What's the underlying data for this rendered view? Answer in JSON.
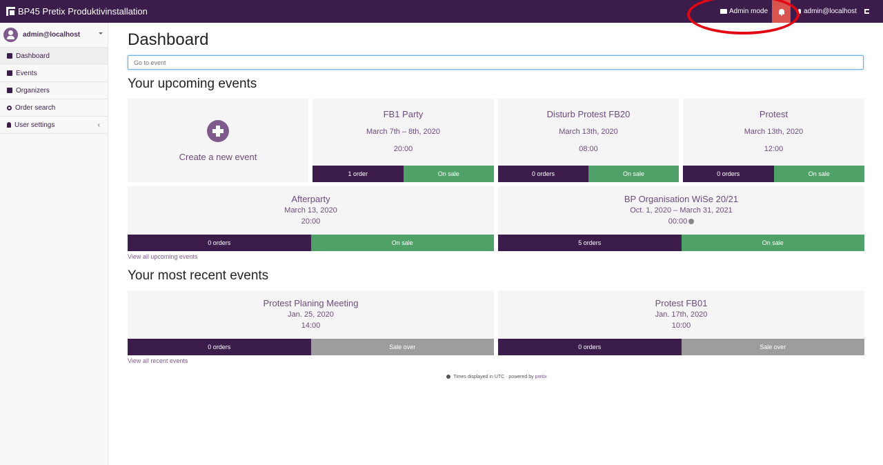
{
  "topbar": {
    "title": "BP45 Pretix Produktivinstallation",
    "admin_mode_label": "Admin mode",
    "user_label": "admin@localhost",
    "colors": {
      "navbar": "#3b1c4a",
      "bell": "#d9534f",
      "annotation": "#e30613"
    }
  },
  "sidebar": {
    "user": "admin@localhost",
    "items": [
      {
        "label": "Dashboard",
        "icon": "dashboard-icon"
      },
      {
        "label": "Events",
        "icon": "calendar-icon"
      },
      {
        "label": "Organizers",
        "icon": "users-icon"
      },
      {
        "label": "Order search",
        "icon": "search-icon"
      },
      {
        "label": "User settings",
        "icon": "user-icon"
      }
    ]
  },
  "main": {
    "title": "Dashboard",
    "search_placeholder": "Go to event",
    "upcoming_title": "Your upcoming events",
    "recent_title": "Your most recent events",
    "create_event_label": "Create a new event",
    "view_upcoming": "View all upcoming events",
    "view_recent": "View all recent events",
    "footer_text": "Times displayed in UTC · powered by",
    "footer_link": "pretix"
  },
  "upcoming": [
    {
      "name": "FB1 Party",
      "date": "March 7th – 8th, 2020",
      "time": "20:00",
      "orders": "1 order",
      "status": "On sale"
    },
    {
      "name": "Disturb Protest FB20",
      "date": "March 13th, 2020",
      "time": "08:00",
      "orders": "0 orders",
      "status": "On sale"
    },
    {
      "name": "Protest",
      "date": "March 13th, 2020",
      "time": "12:00",
      "orders": "0 orders",
      "status": "On sale"
    },
    {
      "name": "Afterparty",
      "date": "March 13, 2020",
      "time": "20:00",
      "orders": "0 orders",
      "status": "On sale"
    },
    {
      "name": "BP Organisation WiSe 20/21",
      "date": "Oct. 1, 2020 – March 31, 2021",
      "time": "00:00",
      "orders": "5 orders",
      "status": "On sale"
    }
  ],
  "recent": [
    {
      "name": "Protest Planing Meeting",
      "date": "Jan. 25, 2020",
      "time": "14:00",
      "orders": "0 orders",
      "status": "Sale over"
    },
    {
      "name": "Protest FB01",
      "date": "Jan. 17th, 2020",
      "time": "10:00",
      "orders": "0 orders",
      "status": "Sale over"
    }
  ]
}
